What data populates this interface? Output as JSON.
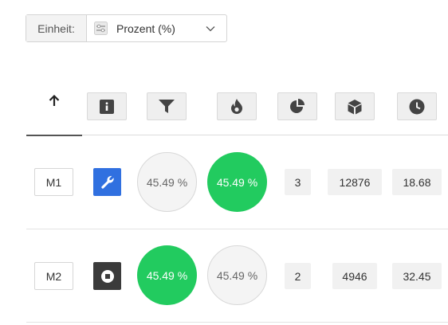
{
  "unit": {
    "label": "Einheit:",
    "selected": "Prozent (%)",
    "icon": "sliders-icon"
  },
  "header": {
    "sort_icon": "arrow-up-icon",
    "columns": [
      {
        "icon": "info-icon"
      },
      {
        "icon": "filter-icon"
      },
      {
        "icon": "flame-icon"
      },
      {
        "icon": "pie-chart-icon"
      },
      {
        "icon": "cube-icon"
      },
      {
        "icon": "clock-icon"
      }
    ]
  },
  "rows": [
    {
      "name": "M1",
      "status_icon": "wrench-icon",
      "status_color": "#3070e0",
      "filter_value": "45.49 %",
      "filter_highlight": false,
      "flame_value": "45.49 %",
      "flame_highlight": true,
      "pie_value": "3",
      "cube_value": "12876",
      "clock_value": "18.68"
    },
    {
      "name": "M2",
      "status_icon": "stop-icon",
      "status_color": "#3b3b3b",
      "filter_value": "45.49 %",
      "filter_highlight": true,
      "flame_value": "45.49 %",
      "flame_highlight": false,
      "pie_value": "2",
      "cube_value": "4946",
      "clock_value": "32.45"
    }
  ],
  "colors": {
    "green": "#22cb5f",
    "blue": "#3070e0",
    "dark": "#3b3b3b"
  }
}
